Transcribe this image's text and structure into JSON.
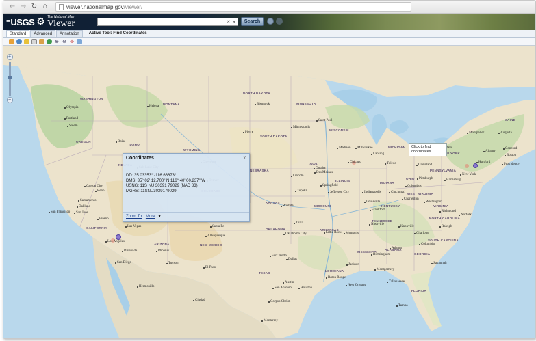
{
  "browser": {
    "url_host": "viewer.nationalmap.gov",
    "url_path": "/viewer/"
  },
  "header": {
    "logo_text": "USGS",
    "logo_sub": "The National Map",
    "app_title": "Viewer",
    "search_button": "Search"
  },
  "tabs": [
    {
      "label": "Standard",
      "active": true
    },
    {
      "label": "Advanced",
      "active": false
    },
    {
      "label": "Annotation",
      "active": false
    }
  ],
  "active_tool": "Active Tool: Find Coordinates",
  "toolbar_icons": [
    "home-icon",
    "globe-icon",
    "layers-icon",
    "print-icon",
    "bookmark-icon",
    "world-icon",
    "zoom-in-icon",
    "zoom-out-icon",
    "pan-icon",
    "identify-icon"
  ],
  "popup": {
    "title": "Coordinates",
    "close": "x",
    "dd": "DD: 35.03353° -116.66673°",
    "dms": "DMS: 35° 02' 12.700\" N     116° 40' 00.237\" W",
    "usng": "USNG: 11S NU 30391 79029 (NAD 83)",
    "mgrs": "MGRS: 11SNU3039179029",
    "zoom_to": "Zoom To",
    "more": "More"
  },
  "tooltip": "Click to find coordinates.",
  "map_labels": {
    "states": [
      {
        "name": "WASHINGTON"
      },
      {
        "name": "MONTANA"
      },
      {
        "name": "NORTH DAKOTA"
      },
      {
        "name": "MINNESOTA"
      },
      {
        "name": "OREGON"
      },
      {
        "name": "IDAHO"
      },
      {
        "name": "WYOMING"
      },
      {
        "name": "SOUTH DAKOTA"
      },
      {
        "name": "WISCONSIN"
      },
      {
        "name": "MICHIGAN"
      },
      {
        "name": "NEBRASKA"
      },
      {
        "name": "IOWA"
      },
      {
        "name": "ILLINOIS"
      },
      {
        "name": "INDIANA"
      },
      {
        "name": "OHIO"
      },
      {
        "name": "KANSAS"
      },
      {
        "name": "MISSOURI"
      },
      {
        "name": "KENTUCKY"
      },
      {
        "name": "NEVADA"
      },
      {
        "name": "UTAH"
      },
      {
        "name": "COLORADO"
      },
      {
        "name": "CALIFORNIA"
      },
      {
        "name": "ARIZONA"
      },
      {
        "name": "NEW MEXICO"
      },
      {
        "name": "OKLAHOMA"
      },
      {
        "name": "ARKANSAS"
      },
      {
        "name": "TEXAS"
      },
      {
        "name": "MISSISSIPPI"
      },
      {
        "name": "ALABAMA"
      },
      {
        "name": "GEORGIA"
      },
      {
        "name": "TENNESSEE"
      },
      {
        "name": "NORTH CAROLINA"
      },
      {
        "name": "SOUTH CAROLINA"
      },
      {
        "name": "VIRGINIA"
      },
      {
        "name": "PENNSYLVANIA"
      },
      {
        "name": "NEW YORK"
      },
      {
        "name": "MAINE"
      },
      {
        "name": "LOUISIANA"
      },
      {
        "name": "FLORIDA"
      },
      {
        "name": "WEST VIRGINIA"
      }
    ],
    "cities": [
      {
        "name": "Olympia"
      },
      {
        "name": "Portland"
      },
      {
        "name": "Salem"
      },
      {
        "name": "Helena"
      },
      {
        "name": "Bismarck"
      },
      {
        "name": "Boise"
      },
      {
        "name": "Pierre"
      },
      {
        "name": "Saint Paul"
      },
      {
        "name": "Minneapolis"
      },
      {
        "name": "Madison"
      },
      {
        "name": "Milwaukee"
      },
      {
        "name": "Lansing"
      },
      {
        "name": "Chicago"
      },
      {
        "name": "Toledo"
      },
      {
        "name": "Cleveland"
      },
      {
        "name": "Buffalo"
      },
      {
        "name": "Montpelier"
      },
      {
        "name": "Augusta"
      },
      {
        "name": "Concord"
      },
      {
        "name": "Boston"
      },
      {
        "name": "Hartford"
      },
      {
        "name": "Providence"
      },
      {
        "name": "Albany"
      },
      {
        "name": "New York"
      },
      {
        "name": "Pittsburgh"
      },
      {
        "name": "Harrisburg"
      },
      {
        "name": "Columbus"
      },
      {
        "name": "Indianapolis"
      },
      {
        "name": "Cincinnati"
      },
      {
        "name": "Charleston"
      },
      {
        "name": "Washington"
      },
      {
        "name": "Richmond"
      },
      {
        "name": "Louisville"
      },
      {
        "name": "Frankfort"
      },
      {
        "name": "Lincoln"
      },
      {
        "name": "Omaha"
      },
      {
        "name": "Des Moines"
      },
      {
        "name": "Springfield"
      },
      {
        "name": "Jefferson City"
      },
      {
        "name": "Topeka"
      },
      {
        "name": "Wichita"
      },
      {
        "name": "Tulsa"
      },
      {
        "name": "Oklahoma City"
      },
      {
        "name": "Little Rock"
      },
      {
        "name": "Memphis"
      },
      {
        "name": "Nashville"
      },
      {
        "name": "Knoxville"
      },
      {
        "name": "Raleigh"
      },
      {
        "name": "Charlotte"
      },
      {
        "name": "Columbia"
      },
      {
        "name": "Atlanta"
      },
      {
        "name": "Birmingham"
      },
      {
        "name": "Montgomery"
      },
      {
        "name": "Jackson"
      },
      {
        "name": "Baton Rouge"
      },
      {
        "name": "New Orleans"
      },
      {
        "name": "Tallahassee"
      },
      {
        "name": "Tampa"
      },
      {
        "name": "Houston"
      },
      {
        "name": "Austin"
      },
      {
        "name": "San Antonio"
      },
      {
        "name": "Corpus Christi"
      },
      {
        "name": "Dallas"
      },
      {
        "name": "Fort Worth"
      },
      {
        "name": "El Paso"
      },
      {
        "name": "Albuquerque"
      },
      {
        "name": "Santa Fe"
      },
      {
        "name": "Phoenix"
      },
      {
        "name": "Tucson"
      },
      {
        "name": "Las Vegas"
      },
      {
        "name": "Los Angeles"
      },
      {
        "name": "Riverside"
      },
      {
        "name": "San Diego"
      },
      {
        "name": "Sacramento"
      },
      {
        "name": "San Francisco"
      },
      {
        "name": "Oakland"
      },
      {
        "name": "San Jose"
      },
      {
        "name": "Fresno"
      },
      {
        "name": "Carson City"
      },
      {
        "name": "Reno"
      },
      {
        "name": "Denver"
      },
      {
        "name": "Salt Lake City"
      },
      {
        "name": "Cheyenne"
      },
      {
        "name": "Hermosillo"
      },
      {
        "name": "Monterrey"
      },
      {
        "name": "Ciudad"
      },
      {
        "name": "Savannah"
      },
      {
        "name": "Norfolk"
      }
    ]
  }
}
